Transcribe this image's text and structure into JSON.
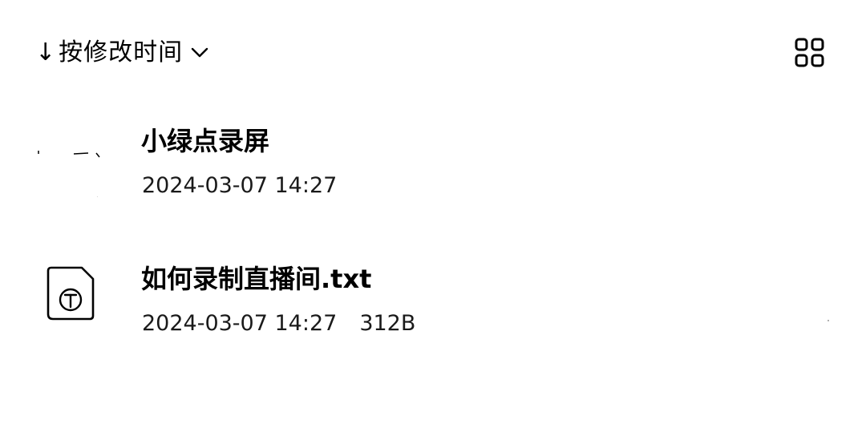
{
  "toolbar": {
    "sort_arrow": "↓",
    "sort_label": "按修改时间",
    "sort_icon": "chevron-down-icon",
    "view_icon": "grid-view-icon"
  },
  "files": [
    {
      "name": "小绿点录屏",
      "modified": "2024-03-07 14:27",
      "size": "",
      "type": "folder"
    },
    {
      "name": "如何录制直播间.txt",
      "modified": "2024-03-07 14:27",
      "size": "312B",
      "type": "txt",
      "icon": "text-file-icon"
    }
  ]
}
